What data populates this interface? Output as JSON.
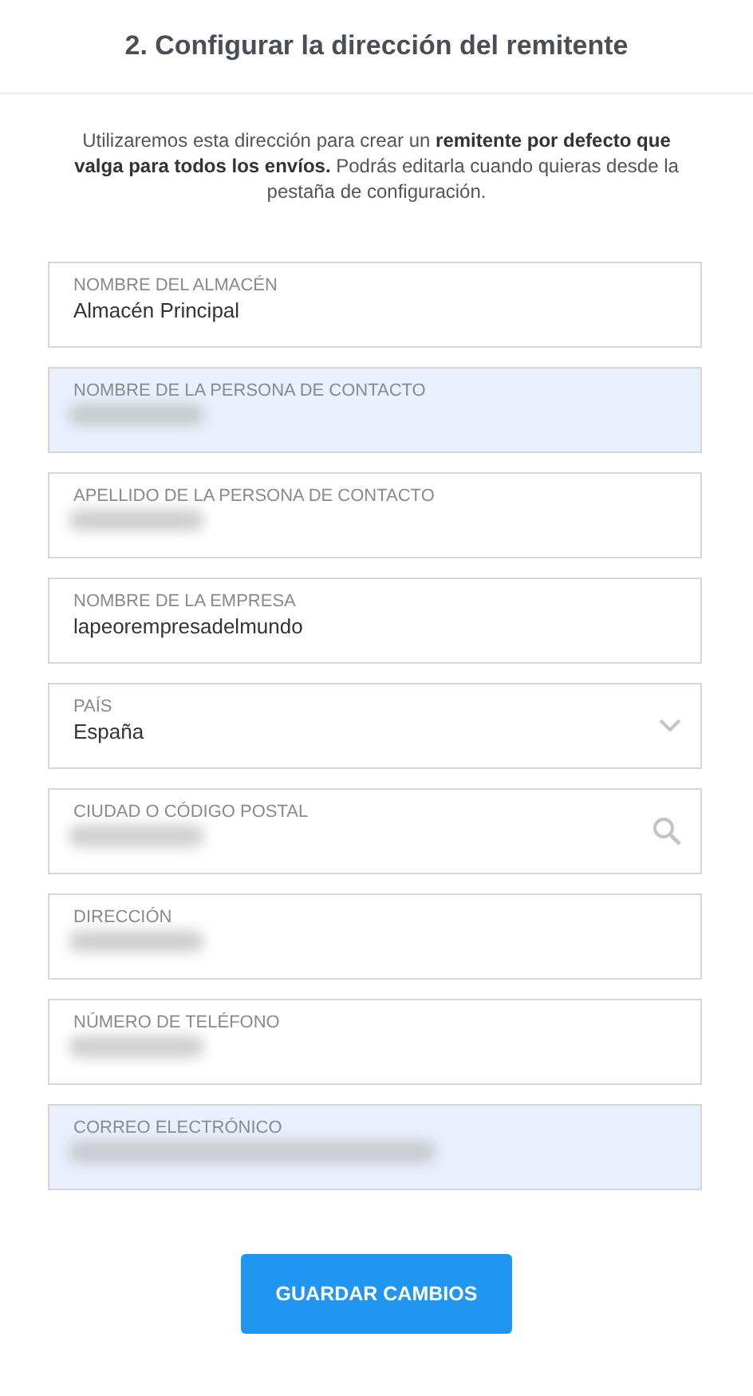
{
  "title": "2. Configurar la dirección del remitente",
  "intro": "Utilizaremos esta dirección para crear un **remitente por defecto que valga para todos los envíos.** Podrás editarla cuando quieras desde la pestaña de configuración.",
  "fields": [
    {
      "kind": "text",
      "label": "NOMBRE DEL ALMACÉN",
      "value": "Almacén Principal",
      "autofilled": false
    },
    {
      "kind": "text",
      "label": "NOMBRE DE LA PERSONA DE CONTACTO",
      "redacted": true,
      "autofilled": true
    },
    {
      "kind": "text",
      "label": "APELLIDO DE LA PERSONA DE CONTACTO",
      "redacted": true,
      "autofilled": false
    },
    {
      "kind": "text",
      "label": "NOMBRE DE LA EMPRESA",
      "value": "lapeorempresadelmundo",
      "autofilled": false
    },
    {
      "kind": "select",
      "label": "PAÍS",
      "value": "España",
      "autofilled": false
    },
    {
      "kind": "search",
      "label": "CIUDAD O CÓDIGO POSTAL",
      "redacted": true,
      "autofilled": false
    },
    {
      "kind": "text",
      "label": "DIRECCIÓN",
      "redacted": true,
      "autofilled": false
    },
    {
      "kind": "text",
      "label": "NÚMERO DE TELÉFONO",
      "redacted": true,
      "autofilled": false
    },
    {
      "kind": "text",
      "label": "CORREO ELECTRÓNICO",
      "redacted": true,
      "autofilled": true
    }
  ],
  "button": "GUARDAR CAMBIOS"
}
